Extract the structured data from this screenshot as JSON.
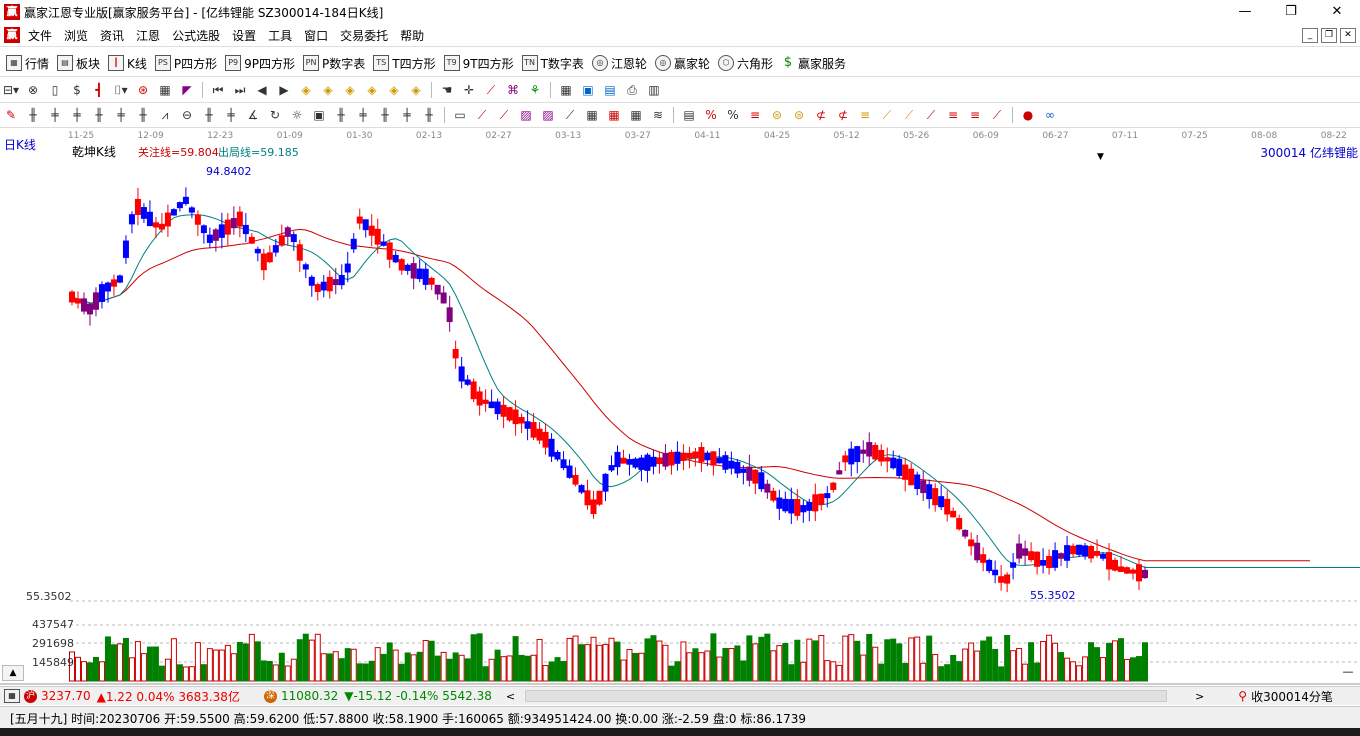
{
  "window": {
    "title": "赢家江恩专业版[赢家服务平台] - [亿纬锂能  SZ300014-184日K线]",
    "logo": "赢"
  },
  "menu": {
    "items": [
      "文件",
      "浏览",
      "资讯",
      "江恩",
      "公式选股",
      "设置",
      "工具",
      "窗口",
      "交易委托",
      "帮助"
    ]
  },
  "toolbar1": {
    "items": [
      {
        "label": "行情",
        "icon": "grid-icon"
      },
      {
        "label": "板块",
        "icon": "block-icon"
      },
      {
        "label": "K线",
        "icon": "candle-icon"
      },
      {
        "label": "P四方形",
        "icon": "PS"
      },
      {
        "label": "9P四方形",
        "icon": "P9"
      },
      {
        "label": "P数字表",
        "icon": "PN"
      },
      {
        "label": "T四方形",
        "icon": "TS"
      },
      {
        "label": "9T四方形",
        "icon": "T9"
      },
      {
        "label": "T数字表",
        "icon": "TN"
      },
      {
        "label": "江恩轮",
        "icon": "wheel-icon"
      },
      {
        "label": "赢家轮",
        "icon": "wheel-icon"
      },
      {
        "label": "六角形",
        "icon": "hex-icon"
      },
      {
        "label": "赢家服务",
        "icon": "dollar-icon"
      }
    ]
  },
  "chart": {
    "period_label": "日K线",
    "indicator_name": "乾坤K线",
    "focus_line_label": "关注线=59.804",
    "exit_line_label": "出局线=59.185",
    "stock_label": "300014  亿纬锂能",
    "high_marker": "94.8402",
    "low_marker": "55.3502",
    "price_axis_label": "55.3502",
    "volume_levels": [
      "437547",
      "291698",
      "145849"
    ],
    "date_labels": [
      "11-25",
      "12-09",
      "12-23",
      "01-09",
      "01-30",
      "02-13",
      "02-27",
      "03-13",
      "03-27",
      "04-11",
      "04-25",
      "05-12",
      "05-26",
      "06-09",
      "06-27",
      "07-11",
      "07-25",
      "08-08",
      "08-22"
    ],
    "colors": {
      "up": "#ff0000",
      "down": "#0000ff",
      "purple": "#800080",
      "slow_ma": "#cc0000",
      "fast_ma": "#008080",
      "vol_up": "#cc0000",
      "vol_down": "#008000"
    }
  },
  "chart_data": {
    "type": "candlestick",
    "x_range": [
      "11-25",
      "08-22"
    ],
    "y_range": [
      55.3502,
      94.8402
    ],
    "high": 94.8402,
    "low": 55.3502,
    "series": [
      {
        "name": "关注线",
        "last": 59.804
      },
      {
        "name": "出局线",
        "last": 59.185
      }
    ],
    "volume_levels": [
      145849,
      291698,
      437547
    ]
  },
  "index_bar": {
    "sh_value": "3237.70",
    "sh_change": "▲1.22 0.04% 3683.38亿",
    "sz_value": "11080.32",
    "sz_change": "▼-15.12 -0.14% 5542.38",
    "right_text": "收300014分笔"
  },
  "info": {
    "text": "[五月十九] 时间:20230706 开:59.5500 高:59.6200 低:57.8800 收:58.1900 手:160065 额:934951424.00 换:0.00 涨:-2.59 盘:0 标:86.1739"
  }
}
